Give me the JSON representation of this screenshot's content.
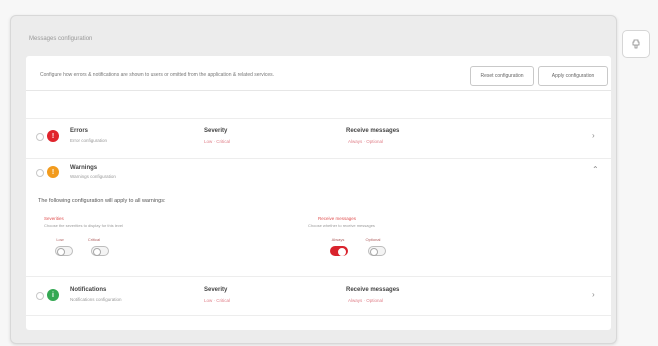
{
  "card": {
    "title": "Messages configuration"
  },
  "description": "Configure how errors & notifications are shown to users or omitted from the application & related services.",
  "buttons": {
    "reset": "Reset configuration",
    "apply": "Apply configuration"
  },
  "columns": {
    "severity": "Severity",
    "receive": "Receive messages"
  },
  "levels": {
    "error": {
      "name": "Errors",
      "sub": "Error configuration",
      "icon": "!",
      "severity": "Low · Critical",
      "receive": "Always · Optional",
      "color": "#e0242c"
    },
    "warning": {
      "name": "Warnings",
      "sub": "Warnings configuration",
      "icon": "!",
      "color": "#f29b1d"
    },
    "notification": {
      "name": "Notifications",
      "sub": "Notifications configuration",
      "icon": "i",
      "severity": "Low · Critical",
      "receive": "Always · Optional",
      "color": "#34a853"
    }
  },
  "warning_expanded": {
    "notice": "The following configuration will apply to all warnings:",
    "severity_group": {
      "title": "Severities",
      "sub": "Choose the severities to display for this level"
    },
    "receive_group": {
      "title": "Receive messages",
      "sub": "Choose whether to receive messages"
    },
    "toggles": [
      {
        "label": "Low",
        "on": false
      },
      {
        "label": "Critical",
        "on": false
      },
      {
        "label": "Always",
        "on": true
      },
      {
        "label": "Optional",
        "on": false
      }
    ]
  },
  "icons": {
    "side": "tool-icon",
    "expand": "chevron-right-icon",
    "collapse": "chevron-up-icon"
  }
}
